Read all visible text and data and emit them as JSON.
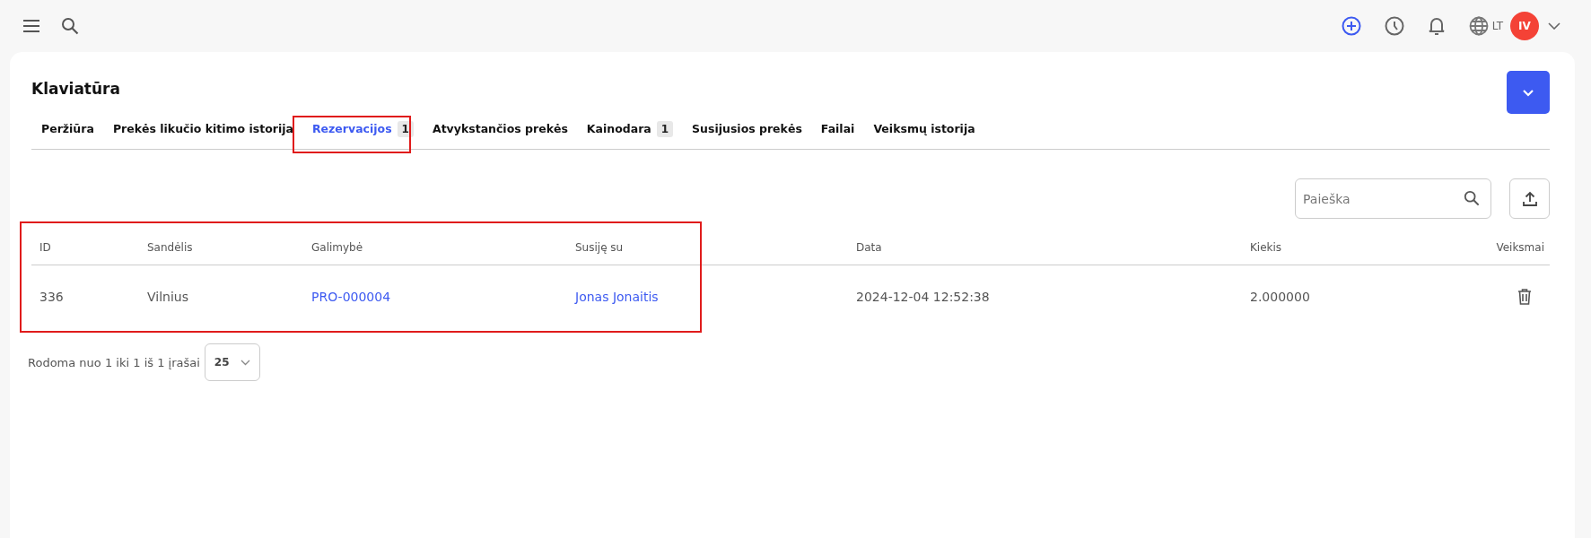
{
  "topbar": {
    "language": "LT",
    "avatar": "IV"
  },
  "page": {
    "title": "Klaviatūra"
  },
  "tabs": [
    {
      "label": "Peržiūra",
      "selected": false
    },
    {
      "label": "Prekės likučio kitimo istorija",
      "selected": false
    },
    {
      "label": "Rezervacijos",
      "badge": "1",
      "selected": true
    },
    {
      "label": "Atvykstančios prekės",
      "selected": false
    },
    {
      "label": "Kainodara",
      "badge": "1",
      "selected": false
    },
    {
      "label": "Susijusios prekės",
      "selected": false
    },
    {
      "label": "Failai",
      "selected": false
    },
    {
      "label": "Veiksmų istorija",
      "selected": false
    }
  ],
  "search": {
    "placeholder": "Paieška"
  },
  "table": {
    "columns": [
      "ID",
      "Sandėlis",
      "Galimybė",
      "Susiję su",
      "Data",
      "Kiekis",
      "Veiksmai"
    ],
    "rows": [
      {
        "cells": [
          {
            "text": "336",
            "kind": "text"
          },
          {
            "text": "Vilnius",
            "kind": "text"
          },
          {
            "text": "PRO-000004",
            "kind": "link"
          },
          {
            "text": "Jonas Jonaitis",
            "kind": "link"
          },
          {
            "text": "2024-12-04 12:52:38",
            "kind": "text"
          },
          {
            "text": "2.000000",
            "kind": "text"
          },
          {
            "kind": "delete"
          }
        ]
      }
    ]
  },
  "footer": {
    "summary": "Rodoma nuo 1 iki 1 iš 1 įrašai",
    "page_size": "25"
  }
}
